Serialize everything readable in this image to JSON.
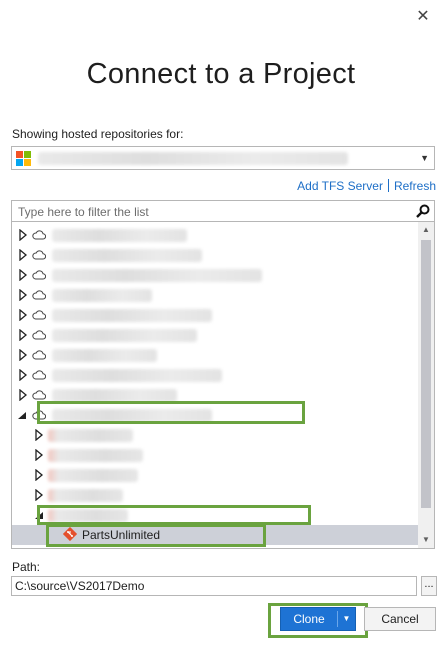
{
  "dialog": {
    "close_symbol": "✕",
    "title": "Connect to a Project"
  },
  "account": {
    "label": "Showing hosted repositories for:",
    "logo_colors": [
      "#f35325",
      "#81bc06",
      "#05a6f0",
      "#ffba08"
    ]
  },
  "links": {
    "add_server": "Add TFS Server",
    "refresh": "Refresh"
  },
  "filter": {
    "placeholder": "Type here to filter the list"
  },
  "tree": {
    "selected_repo": "PartsUnlimited",
    "selected_repo_icon": "git-repo-icon",
    "selection_color": "#cdd0d8"
  },
  "path": {
    "label": "Path:",
    "value": "C:\\source\\VS2017Demo",
    "browse_label": "..."
  },
  "buttons": {
    "clone": "Clone",
    "cancel": "Cancel"
  },
  "colors": {
    "accent": "#1e73d4",
    "link": "#1e6fc7",
    "highlight": "#6aa33f"
  }
}
